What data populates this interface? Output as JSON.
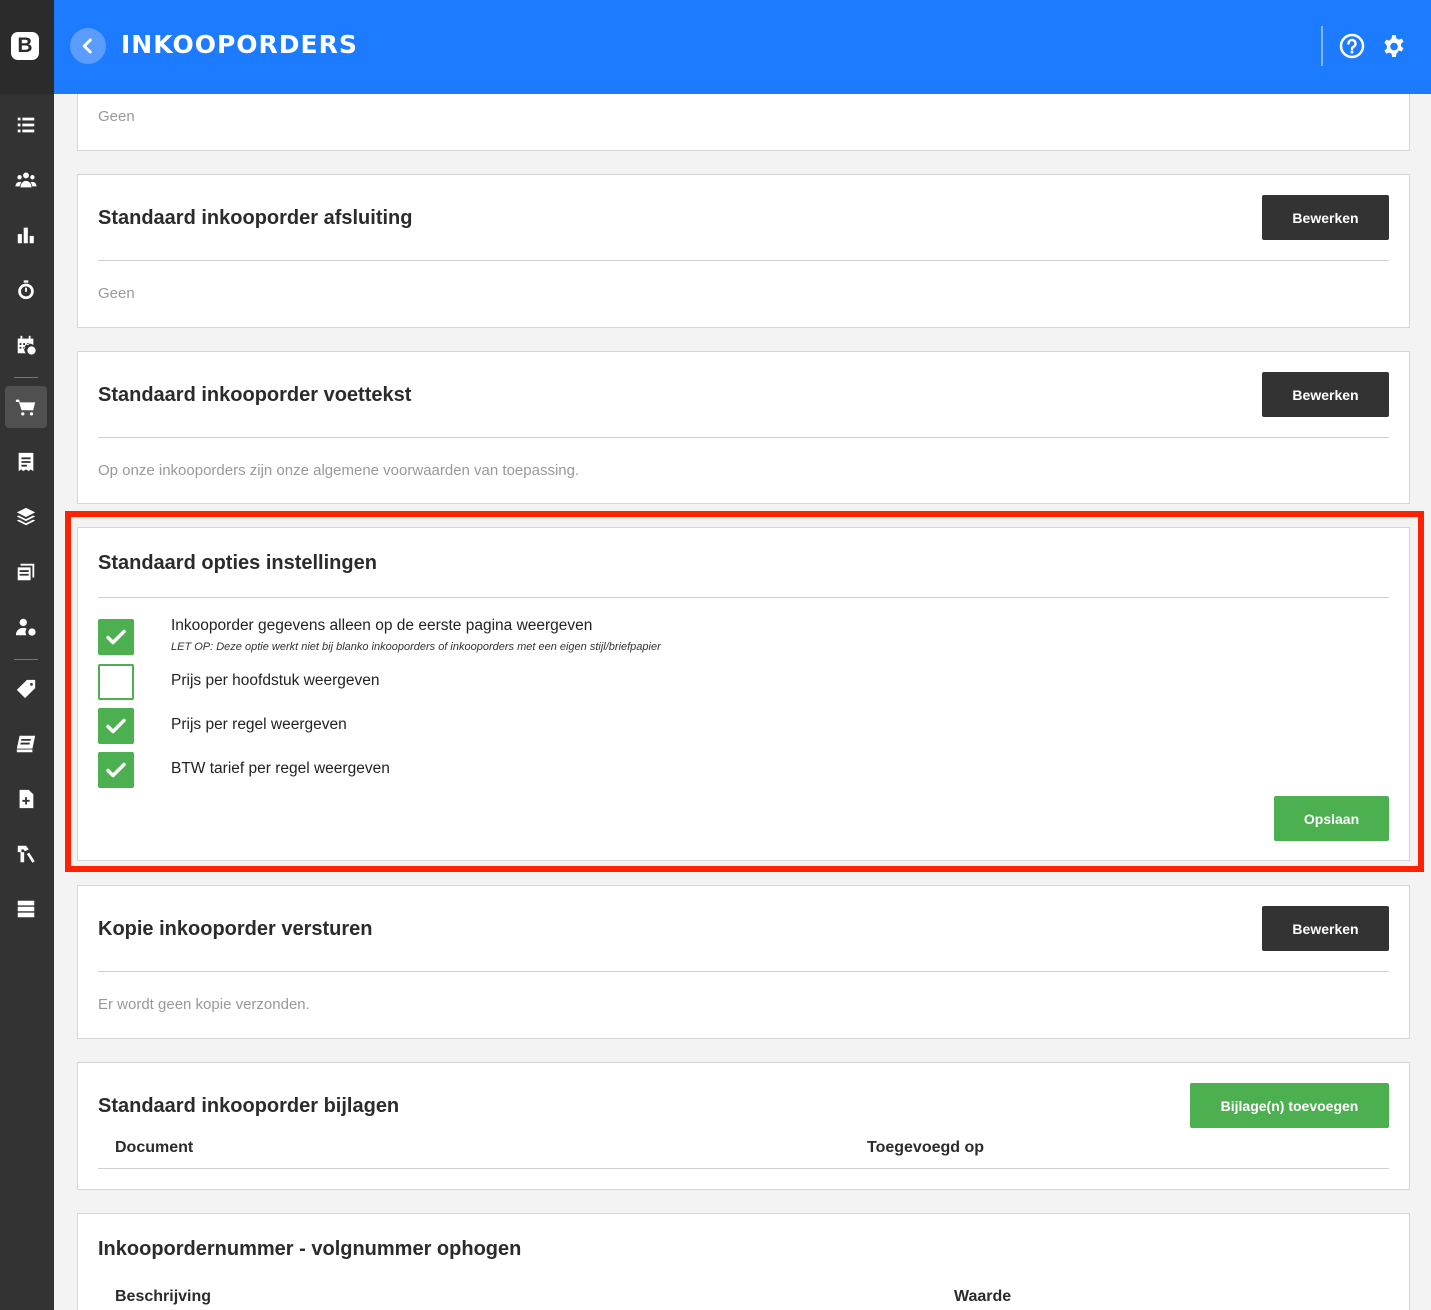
{
  "app": {
    "logo_letter": "B",
    "title": "INKOOPORDERS"
  },
  "sidebar": {
    "items": [
      {
        "icon": "list-icon"
      },
      {
        "icon": "users-icon"
      },
      {
        "icon": "bar-chart-icon"
      },
      {
        "icon": "stopwatch-icon"
      },
      {
        "icon": "calendar-icon"
      },
      {
        "icon": "cart-icon",
        "active": true
      },
      {
        "icon": "receipt-icon"
      },
      {
        "icon": "layers-icon"
      },
      {
        "icon": "document-list-icon"
      },
      {
        "icon": "user-settings-icon"
      },
      {
        "icon": "tag-icon"
      },
      {
        "icon": "book-icon"
      },
      {
        "icon": "file-plus-icon"
      },
      {
        "icon": "tools-icon"
      },
      {
        "icon": "server-icon"
      }
    ]
  },
  "cards": {
    "top": {
      "text": "Geen"
    },
    "afsluiting": {
      "title": "Standaard inkooporder afsluiting",
      "button": "Bewerken",
      "text": "Geen"
    },
    "voettekst": {
      "title": "Standaard inkooporder voettekst",
      "button": "Bewerken",
      "text": "Op onze inkooporders zijn onze algemene voorwaarden van toepassing."
    },
    "opties": {
      "title": "Standaard opties instellingen",
      "options": [
        {
          "label": "Inkooporder gegevens alleen op de eerste pagina weergeven",
          "note": "LET OP: Deze optie werkt niet bij blanko inkooporders of inkooporders met een eigen stijl/briefpapier",
          "checked": true
        },
        {
          "label": "Prijs per hoofdstuk weergeven",
          "checked": false
        },
        {
          "label": "Prijs per regel weergeven",
          "checked": true
        },
        {
          "label": "BTW tarief per regel weergeven",
          "checked": true
        }
      ],
      "save": "Opslaan"
    },
    "kopie": {
      "title": "Kopie inkooporder versturen",
      "button": "Bewerken",
      "text": "Er wordt geen kopie verzonden."
    },
    "bijlagen": {
      "title": "Standaard inkooporder bijlagen",
      "button": "Bijlage(n) toevoegen",
      "col1": "Document",
      "col2": "Toegevoegd op"
    },
    "volgnummer": {
      "title": "Inkoopordernummer - volgnummer ophogen",
      "col1": "Beschrijving",
      "col2": "Waarde"
    }
  },
  "colors": {
    "header": "#1c7bff",
    "sidebar": "#333333",
    "green": "#4caf50",
    "dark_button": "#333333",
    "highlight": "#ff2200"
  }
}
